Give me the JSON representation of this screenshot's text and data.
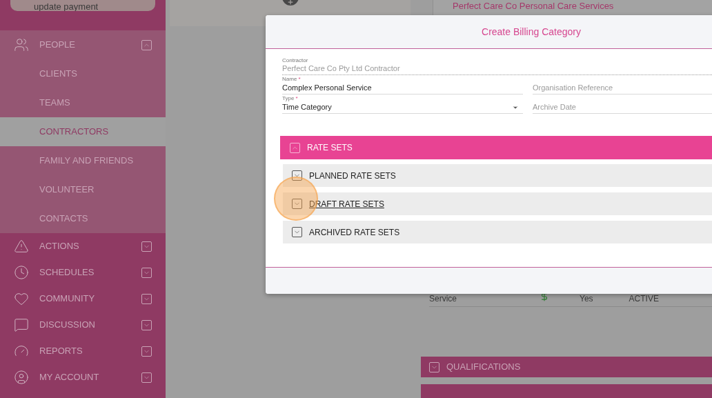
{
  "sidebar": {
    "payment_button": "update payment",
    "items": [
      {
        "label": "PEOPLE",
        "expanded": true,
        "children": [
          {
            "label": "CLIENTS",
            "selected": false
          },
          {
            "label": "TEAMS",
            "selected": false
          },
          {
            "label": "CONTRACTORS",
            "selected": true
          },
          {
            "label": "FAMILY AND FRIENDS",
            "selected": false
          },
          {
            "label": "VOLUNTEER",
            "selected": false
          },
          {
            "label": "CONTACTS",
            "selected": false
          }
        ]
      },
      {
        "label": "ACTIONS",
        "expanded": false
      },
      {
        "label": "SCHEDULES",
        "expanded": false
      },
      {
        "label": "COMMUNITY",
        "expanded": false
      },
      {
        "label": "DISCUSSION",
        "expanded": false
      },
      {
        "label": "REPORTS",
        "expanded": false
      },
      {
        "label": "MY ACCOUNT",
        "expanded": false
      }
    ]
  },
  "background": {
    "card_title": "Perfect Care Co Personal Care Services",
    "row": {
      "name": "Service",
      "column_3": "Yes",
      "status": "ACTIVE"
    },
    "sections": [
      {
        "label": "QUALIFICATIONS",
        "expanded": false
      }
    ]
  },
  "dialog": {
    "title": "Create Billing Category",
    "contractor": {
      "label": "Contractor",
      "value": "Perfect Care Co Pty Ltd Contractor"
    },
    "name": {
      "label": "Name",
      "required_mark": "*",
      "value": "Complex Personal Service"
    },
    "organisation_reference": {
      "placeholder": "Organisation Reference"
    },
    "type": {
      "label": "Type",
      "required_mark": "*",
      "value": "Time Category"
    },
    "archive_date": {
      "placeholder": "Archive Date"
    },
    "rate_sets": {
      "label": "RATE SETS",
      "expanded": true,
      "subsections": [
        {
          "label": "PLANNED RATE SETS",
          "expanded": false,
          "hovered": false
        },
        {
          "label": "DRAFT RATE SETS",
          "expanded": false,
          "hovered": true
        },
        {
          "label": "ARCHIVED RATE SETS",
          "expanded": false,
          "hovered": false
        }
      ]
    }
  }
}
